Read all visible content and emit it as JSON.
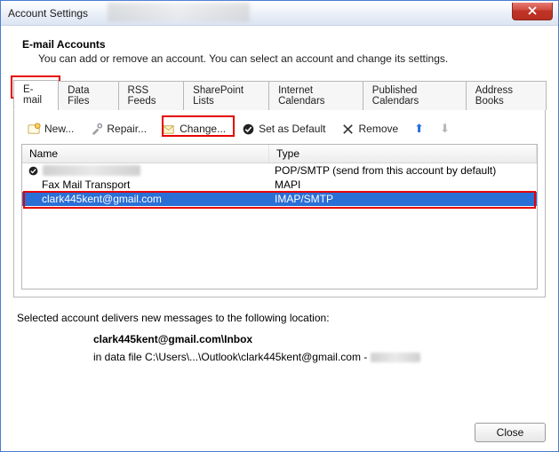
{
  "window": {
    "title": "Account Settings"
  },
  "header": {
    "title": "E-mail Accounts",
    "subtitle": "You can add or remove an account. You can select an account and change its settings."
  },
  "tabs": [
    {
      "label": "E-mail",
      "active": true
    },
    {
      "label": "Data Files"
    },
    {
      "label": "RSS Feeds"
    },
    {
      "label": "SharePoint Lists"
    },
    {
      "label": "Internet Calendars"
    },
    {
      "label": "Published Calendars"
    },
    {
      "label": "Address Books"
    }
  ],
  "toolbar": {
    "new": "New...",
    "repair": "Repair...",
    "change": "Change...",
    "default": "Set as Default",
    "remove": "Remove"
  },
  "list": {
    "cols": {
      "name": "Name",
      "type": "Type"
    },
    "rows": [
      {
        "name": "",
        "type": "POP/SMTP (send from this account by default)",
        "default": true,
        "blurred": true
      },
      {
        "name": "Fax Mail Transport",
        "type": "MAPI"
      },
      {
        "name": "clark445kent@gmail.com",
        "type": "IMAP/SMTP",
        "selected": true
      }
    ]
  },
  "footer": {
    "note": "Selected account delivers new messages to the following location:",
    "loc_bold": "clark445kent@gmail.com\\Inbox",
    "loc_path_prefix": "in data file C:\\Users\\...\\Outlook\\clark445kent@gmail.com - "
  },
  "buttons": {
    "close": "Close"
  }
}
